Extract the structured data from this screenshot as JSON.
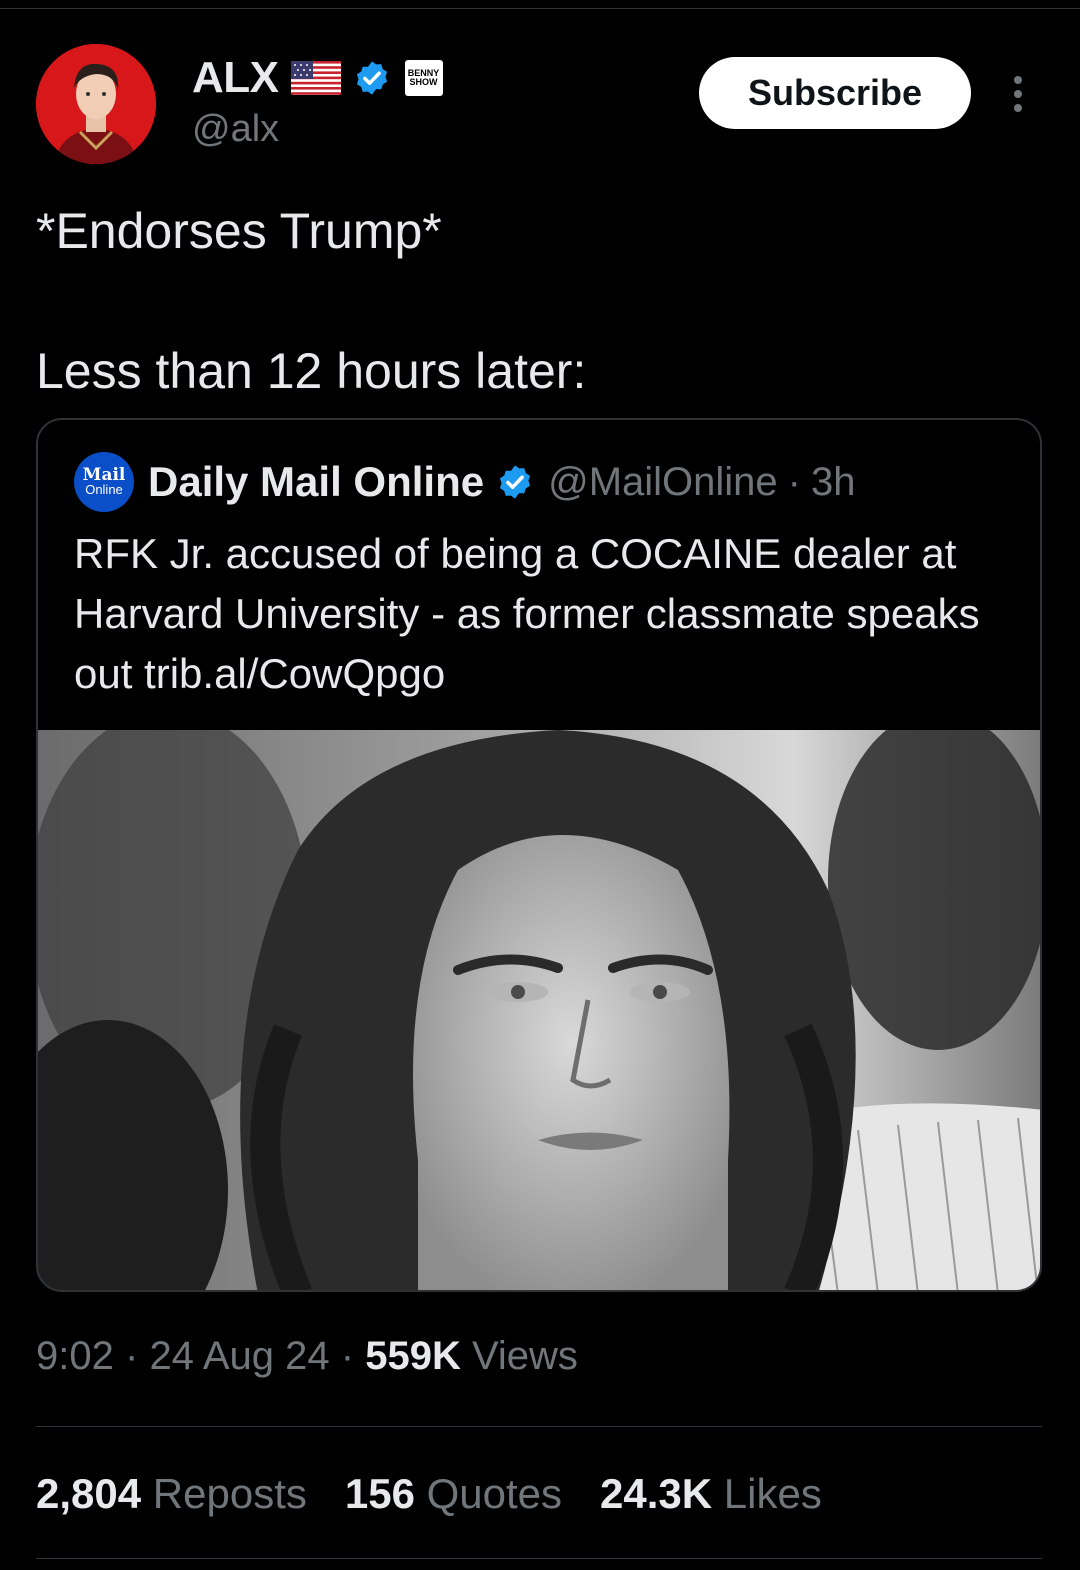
{
  "author": {
    "name": "ALX",
    "handle": "@alx",
    "badge_text": "BENNY SHOW",
    "subscribe_label": "Subscribe"
  },
  "tweet": {
    "line1": "*Endorses Trump*",
    "line2": "Less than 12 hours later:"
  },
  "quote": {
    "logo_line1": "Mail",
    "logo_line2": "Online",
    "name": "Daily Mail Online",
    "handle": "@MailOnline",
    "separator": "·",
    "time": "3h",
    "text": "RFK Jr. accused of being a COCAINE dealer at Harvard University - as former classmate speaks out trib.al/CowQpgo"
  },
  "meta": {
    "time": "9:02",
    "sep": "·",
    "date": "24 Aug 24",
    "views_count": "559K",
    "views_label": "Views"
  },
  "stats": {
    "reposts_count": "2,804",
    "reposts_label": "Reposts",
    "quotes_count": "156",
    "quotes_label": "Quotes",
    "likes_count": "24.3K",
    "likes_label": "Likes"
  },
  "icons": {
    "verified": "verified-badge-icon",
    "flag": "us-flag-icon",
    "more": "more-options-icon"
  },
  "colors": {
    "background": "#000000",
    "text": "#e7e9ea",
    "muted": "#71767b",
    "border": "#2f3336",
    "verified": "#1d9bf0",
    "mail_logo": "#0b4fc8"
  }
}
